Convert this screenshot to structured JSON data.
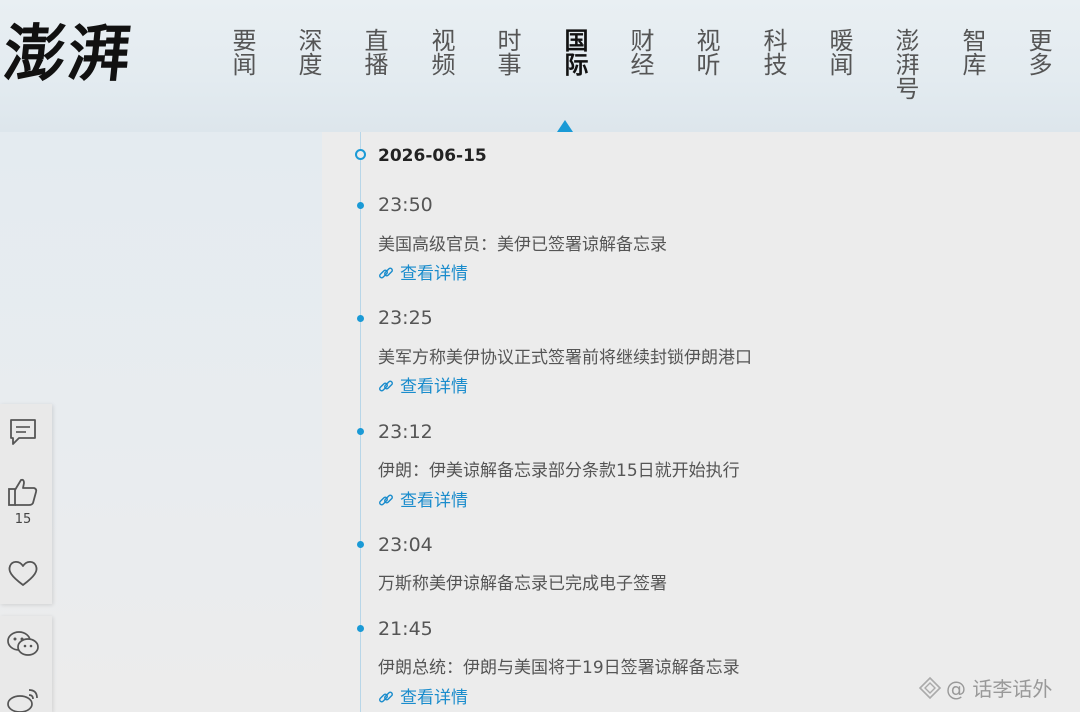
{
  "header": {
    "logo_text": "澎湃",
    "nav": [
      {
        "label": "要闻",
        "active": false
      },
      {
        "label": "深度",
        "active": false
      },
      {
        "label": "直播",
        "active": false
      },
      {
        "label": "视频",
        "active": false
      },
      {
        "label": "时事",
        "active": false
      },
      {
        "label": "国际",
        "active": true
      },
      {
        "label": "财经",
        "active": false
      },
      {
        "label": "视听",
        "active": false
      },
      {
        "label": "科技",
        "active": false
      },
      {
        "label": "暖闻",
        "active": false
      },
      {
        "label": "澎湃号",
        "active": false
      },
      {
        "label": "智库",
        "active": false
      },
      {
        "label": "更多",
        "active": false
      }
    ]
  },
  "sidebar": {
    "like_count": "15",
    "icons": [
      "comment-icon",
      "thumbs-up-icon",
      "heart-icon",
      "wechat-icon",
      "weibo-icon"
    ]
  },
  "timeline": {
    "date": "2026-06-15",
    "link_label": "查看详情",
    "items": [
      {
        "time": "23:50",
        "headline": "美国高级官员：美伊已签署谅解备忘录",
        "has_link": true
      },
      {
        "time": "23:25",
        "headline": "美军方称美伊协议正式签署前将继续封锁伊朗港口",
        "has_link": true
      },
      {
        "time": "23:12",
        "headline": "伊朗：伊美谅解备忘录部分条款15日就开始执行",
        "has_link": true
      },
      {
        "time": "23:04",
        "headline": "万斯称美伊谅解备忘录已完成电子签署",
        "has_link": false
      },
      {
        "time": "21:45",
        "headline": "伊朗总统：伊朗与美国将于19日签署谅解备忘录",
        "has_link": true
      }
    ]
  },
  "watermark": {
    "text": "@ 话李话外"
  },
  "colors": {
    "accent": "#1a9ad6",
    "link": "#1a8ccc"
  }
}
